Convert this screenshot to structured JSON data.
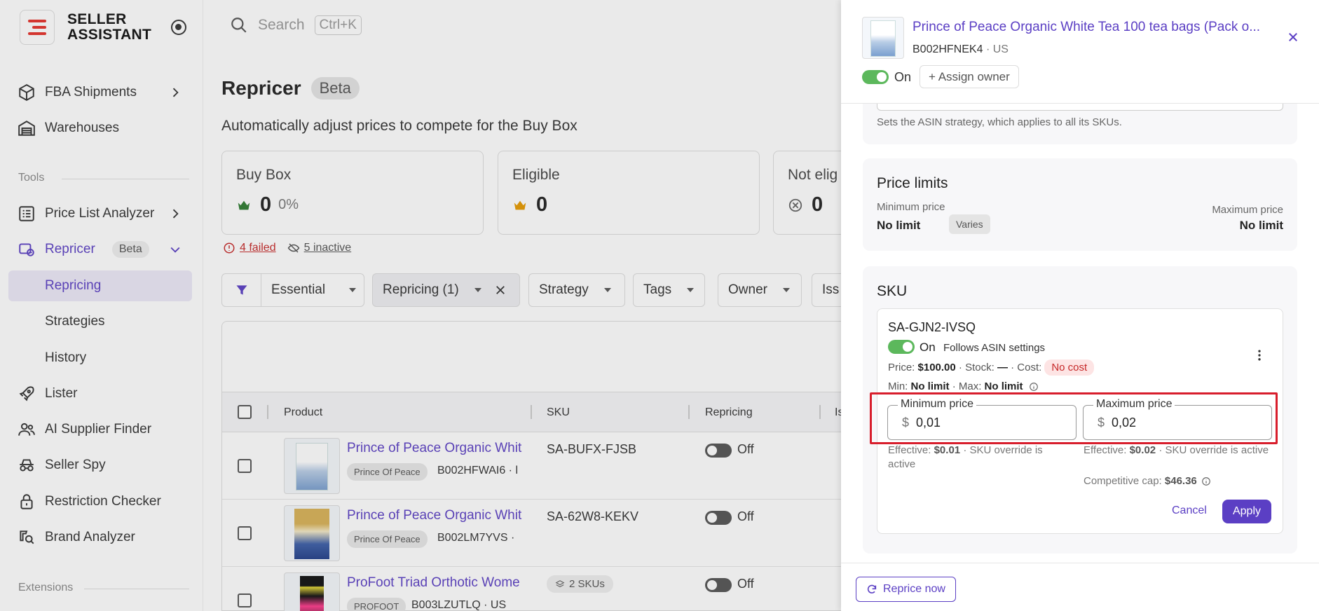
{
  "brand": {
    "name_line1": "SELLER",
    "name_line2": "ASSISTANT",
    "accent": "#e5312b"
  },
  "search": {
    "placeholder": "Search",
    "shortcut": "Ctrl+K"
  },
  "sidebar": {
    "items": [
      {
        "label": "FBA Shipments",
        "icon": "box-icon"
      },
      {
        "label": "Warehouses",
        "icon": "warehouse-icon"
      }
    ],
    "tools_label": "Tools",
    "tools": [
      {
        "label": "Price List Analyzer",
        "icon": "list-icon"
      },
      {
        "label": "Repricer",
        "icon": "repricer-icon",
        "badge": "Beta"
      },
      {
        "label": "Repricing"
      },
      {
        "label": "Strategies"
      },
      {
        "label": "History"
      },
      {
        "label": "Lister",
        "icon": "rocket-icon"
      },
      {
        "label": "AI Supplier Finder",
        "icon": "people-icon"
      },
      {
        "label": "Seller Spy",
        "icon": "spy-icon"
      },
      {
        "label": "Restriction Checker",
        "icon": "lock-icon"
      },
      {
        "label": "Brand Analyzer",
        "icon": "brand-search-icon"
      }
    ],
    "extensions_label": "Extensions"
  },
  "main": {
    "title": "Repricer",
    "title_badge": "Beta",
    "subtitle": "Automatically adjust prices to compete for the Buy Box",
    "stats": [
      {
        "label": "Buy Box",
        "value": "0",
        "pct": "0%",
        "icon": "crown-green-icon"
      },
      {
        "label": "Eligible",
        "value": "0",
        "icon": "crown-orange-icon"
      },
      {
        "label": "Not elig",
        "value": "0",
        "icon": "x-circle-icon"
      }
    ],
    "alerts": {
      "failed": "4 failed",
      "inactive": "5 inactive"
    },
    "filters": {
      "view": "Essential",
      "repricing": "Repricing (1)",
      "strategy": "Strategy",
      "tags": "Tags",
      "owner": "Owner",
      "issues": "Iss"
    },
    "table": {
      "headers": {
        "product": "Product",
        "sku": "SKU",
        "repricing": "Repricing",
        "issues": "Is"
      },
      "rows": [
        {
          "title": "Prince of Peace Organic Whit",
          "brand": "Prince Of Peace",
          "asin": "B002HFWAI6 · l",
          "sku": "SA-BUFX-FJSB",
          "repricing": "Off"
        },
        {
          "title": "Prince of Peace Organic Whit",
          "brand": "Prince Of Peace",
          "asin": "B002LM7YVS ·",
          "sku": "SA-62W8-KEKV",
          "repricing": "Off"
        },
        {
          "title": "ProFoot Triad Orthotic Wome",
          "brand": "PROFOOT",
          "asin": "B003LZUTLQ · US",
          "sku": "2 SKUs",
          "repricing": "Off"
        }
      ]
    }
  },
  "drawer": {
    "title": "Prince of Peace Organic White Tea 100 tea bags (Pack o...",
    "asin": "B002HFNEK4",
    "marketplace": "US",
    "status": "On",
    "assign_owner": "+ Assign owner",
    "strategy_hint": "Sets the ASIN strategy, which applies to all its SKUs.",
    "price_limits": {
      "title": "Price limits",
      "min_label": "Minimum price",
      "min_value": "No limit",
      "min_badge": "Varies",
      "max_label": "Maximum price",
      "max_value": "No limit"
    },
    "sku_section": {
      "title": "SKU",
      "sku": "SA-GJN2-IVSQ",
      "status": "On",
      "follows": "Follows ASIN settings",
      "price_label": "Price:",
      "price": "$100.00",
      "stock_label": "· Stock:",
      "stock": "—",
      "cost_label": "· Cost:",
      "cost_badge": "No cost",
      "min_label": "Min:",
      "min": "No limit",
      "max_label": "· Max:",
      "max": "No limit",
      "min_input_label": "Minimum price",
      "min_input_value": "0,01",
      "max_input_label": "Maximum price",
      "max_input_value": "0,02",
      "currency": "$",
      "min_effective_prefix": "Effective:",
      "min_effective": "$0.01",
      "min_effective_suffix": "· SKU override is",
      "override_active": "active",
      "max_effective_prefix": "Effective:",
      "max_effective": "$0.02",
      "max_effective_suffix": "· SKU override is",
      "cap_label": "Competitive cap:",
      "cap_value": "$46.36",
      "cancel": "Cancel",
      "apply": "Apply"
    },
    "reprice_now": "Reprice now"
  }
}
